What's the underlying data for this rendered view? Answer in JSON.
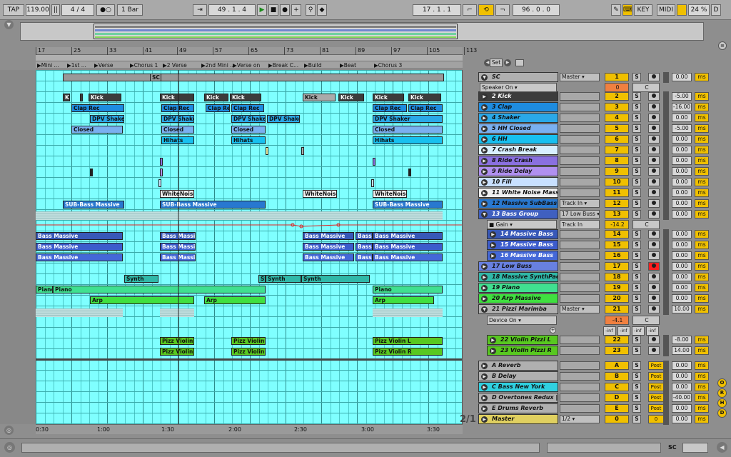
{
  "toolbar": {
    "tap": "TAP",
    "tempo": "119.00",
    "meter": "4 / 4",
    "quant": "1 Bar",
    "position": "49 . 1 . 4",
    "loop_start": "17 . 1 . 1",
    "loop_length": "96 . 0 . 0",
    "key": "KEY",
    "midi": "MIDI",
    "cpu": "24 %",
    "d": "D"
  },
  "ruler": {
    "bars": [
      "17",
      "25",
      "33",
      "41",
      "49",
      "57",
      "65",
      "73",
      "81",
      "89",
      "97",
      "105",
      "113"
    ]
  },
  "locators": [
    "Mini ...",
    "1st ...",
    "Verse",
    "Chorus 1",
    "2 Verse",
    "2nd Mini ...",
    "Verse on",
    "Break C...",
    "Build",
    "Beat",
    "Chorus 3"
  ],
  "time_labels": [
    "0:30",
    "1:00",
    "1:30",
    "2:00",
    "2:30",
    "3:00",
    "3:30"
  ],
  "page_indicator": "2/1",
  "colors": {
    "arrangement_bg": "#7fffff",
    "accent": "#f0c000",
    "arm_red": "#ff2020"
  },
  "tracks": [
    {
      "name": "SC",
      "color": "#b0b0b0",
      "io": "Master",
      "num": "1",
      "vol": "0.00",
      "group": true
    },
    {
      "name": "2 Kick",
      "color": "#3c3c3c",
      "dark": true,
      "io": "",
      "num": "2",
      "vol": "-5.00"
    },
    {
      "name": "3 Clap",
      "color": "#1e8ce0",
      "io": "",
      "num": "3",
      "vol": "-16.00"
    },
    {
      "name": "4 Shaker",
      "color": "#2aa8e8",
      "io": "",
      "num": "4",
      "vol": "0.00"
    },
    {
      "name": "5 HH Closed",
      "color": "#7ab0f0",
      "io": "",
      "num": "5",
      "vol": "-5.00"
    },
    {
      "name": "6 HH",
      "color": "#18c0f0",
      "io": "",
      "num": "6",
      "vol": "0.00"
    },
    {
      "name": "7 Crash Break",
      "color": "#d8f0ff",
      "io": "",
      "num": "7",
      "vol": "0.00"
    },
    {
      "name": "8 Ride Crash",
      "color": "#8a70e0",
      "io": "",
      "num": "8",
      "vol": "0.00"
    },
    {
      "name": "9 Ride Delay",
      "color": "#b090f0",
      "io": "",
      "num": "9",
      "vol": "0.00"
    },
    {
      "name": "10 Fill",
      "color": "#c8e0ff",
      "io": "",
      "num": "10",
      "vol": "0.00"
    },
    {
      "name": "11 White Noise Massi",
      "color": "#f0f0f0",
      "io": "",
      "num": "11",
      "vol": "0.00"
    },
    {
      "name": "12 Massive SubBass",
      "color": "#2878d0",
      "io": "Track In",
      "num": "12",
      "vol": "0.00"
    },
    {
      "name": "13 Bass Group",
      "color": "#4060c0",
      "dark": true,
      "io": "17 Low Buss",
      "num": "13",
      "vol": "0.00",
      "group": true
    },
    {
      "name": "14 Massive Bass",
      "color": "#3858b8",
      "dark": true,
      "io": "",
      "num": "14",
      "vol": "0.00",
      "indent": true
    },
    {
      "name": "15 Massive Bass",
      "color": "#3c5ccc",
      "dark": true,
      "io": "",
      "num": "15",
      "vol": "0.00",
      "indent": true
    },
    {
      "name": "16 Massive Bass",
      "color": "#4468d8",
      "dark": true,
      "io": "",
      "num": "16",
      "vol": "0.00",
      "indent": true
    },
    {
      "name": "17 Low Buss",
      "color": "#6880e0",
      "io": "",
      "num": "17",
      "vol": "0.00"
    },
    {
      "name": "18 Massive SynthPad",
      "color": "#30b8a8",
      "io": "",
      "num": "18",
      "vol": "0.00"
    },
    {
      "name": "19 Piano",
      "color": "#40e090",
      "io": "",
      "num": "19",
      "vol": "0.00"
    },
    {
      "name": "20 Arp Massive",
      "color": "#40e040",
      "io": "",
      "num": "20",
      "vol": "0.00"
    },
    {
      "name": "21 Pizzi Marimba",
      "color": "#b0b0b0",
      "io": "Master",
      "num": "21",
      "vol": "10.00",
      "group": true
    },
    {
      "name": "22 Violin Pizzi L",
      "color": "#58c820",
      "io": "",
      "num": "22",
      "vol": "-8.00",
      "indent": true
    },
    {
      "name": "23 Violin Pizzi R",
      "color": "#58c820",
      "io": "",
      "num": "23",
      "vol": "14.00",
      "indent": true
    },
    {
      "name": "A Reverb",
      "color": "#b0b0b0",
      "io": "",
      "num": "A",
      "vol": "0.00",
      "post": "Post"
    },
    {
      "name": "B Delay",
      "color": "#b0b0b0",
      "io": "",
      "num": "B",
      "vol": "0.00",
      "post": "Post"
    },
    {
      "name": "C Bass New York",
      "color": "#30d0e0",
      "io": "",
      "num": "C",
      "vol": "0.00",
      "post": "Post"
    },
    {
      "name": "D Overtones Redux |",
      "color": "#b0b0b0",
      "io": "",
      "num": "D",
      "vol": "-40.00",
      "post": "Post"
    },
    {
      "name": "E Drums Reverb",
      "color": "#b0b0b0",
      "io": "",
      "num": "E",
      "vol": "0.00",
      "post": "Post"
    },
    {
      "name": "Master",
      "color": "#e0d060",
      "io": "1/2",
      "num": "0",
      "vol": "0.00",
      "post": "0"
    }
  ],
  "subrows": {
    "sc_device": "Speaker On",
    "sc_val": "0",
    "sc_c": "C",
    "gain": "Gain",
    "gain_in": "Track In",
    "gain_val": "-14.2",
    "gain_c": "C",
    "pizzi_device": "Device On",
    "pizzi_val": "-4.1",
    "pizzi_c": "C",
    "inf": [
      "-inf",
      "-inf",
      "-inf",
      "-inf"
    ]
  },
  "buttons": {
    "set": "Set",
    "s": "S",
    "ms": "ms"
  },
  "right_panel": [
    "O",
    "R",
    "H",
    "D"
  ],
  "status": {
    "sc": "SC"
  }
}
